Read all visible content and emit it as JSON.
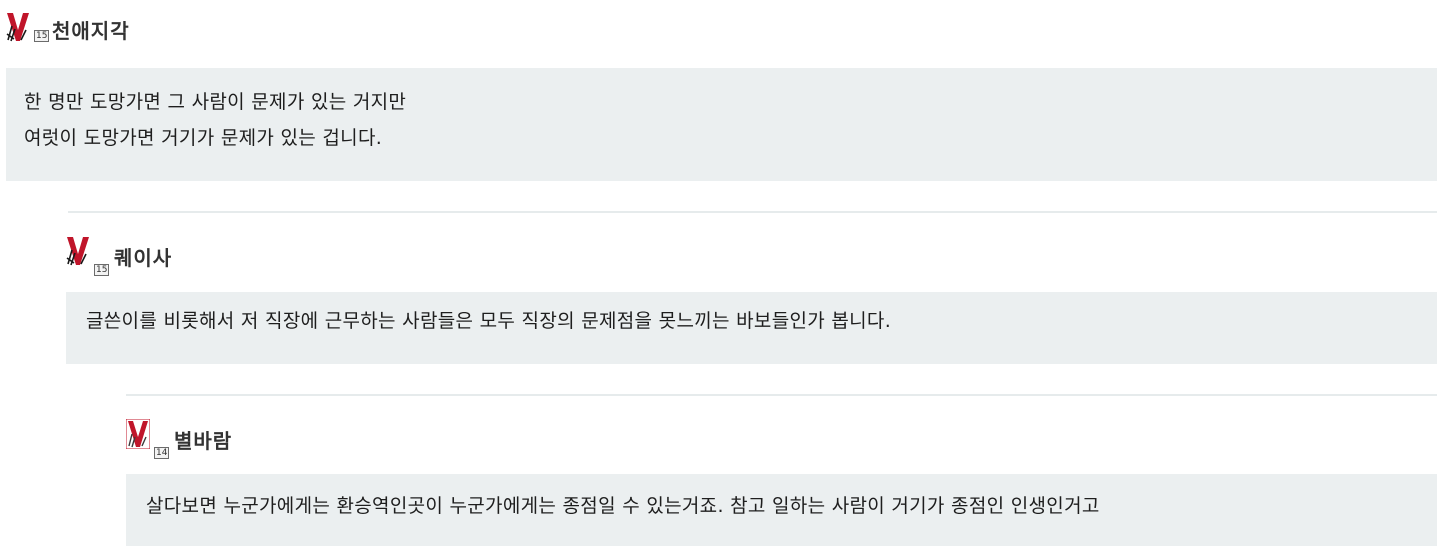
{
  "comments": [
    {
      "author": "천애지각",
      "level": "15",
      "lines": [
        "한 명만 도망가면 그 사람이 문제가 있는 거지만",
        "여럿이 도망가면 거기가 문제가 있는 겁니다."
      ]
    },
    {
      "author": "퀘이사",
      "level": "15",
      "lines": [
        "글쓴이를 비롯해서 저 직장에 근무하는 사람들은 모두 직장의 문제점을 못느끼는 바보들인가 봅니다."
      ]
    },
    {
      "author": "별바람",
      "level": "14",
      "lines": [
        "살다보면 누군가에게는 환승역인곳이 누군가에게는 종점일 수 있는거죠. 참고 일하는 사람이 거기가 종점인 인생인거고"
      ]
    }
  ],
  "colors": {
    "comment_bg": "#ebeff0",
    "separator": "#e6ebec",
    "avatar_red": "#c0152a"
  },
  "icons": {
    "avatar": "red-v-logo-icon"
  }
}
